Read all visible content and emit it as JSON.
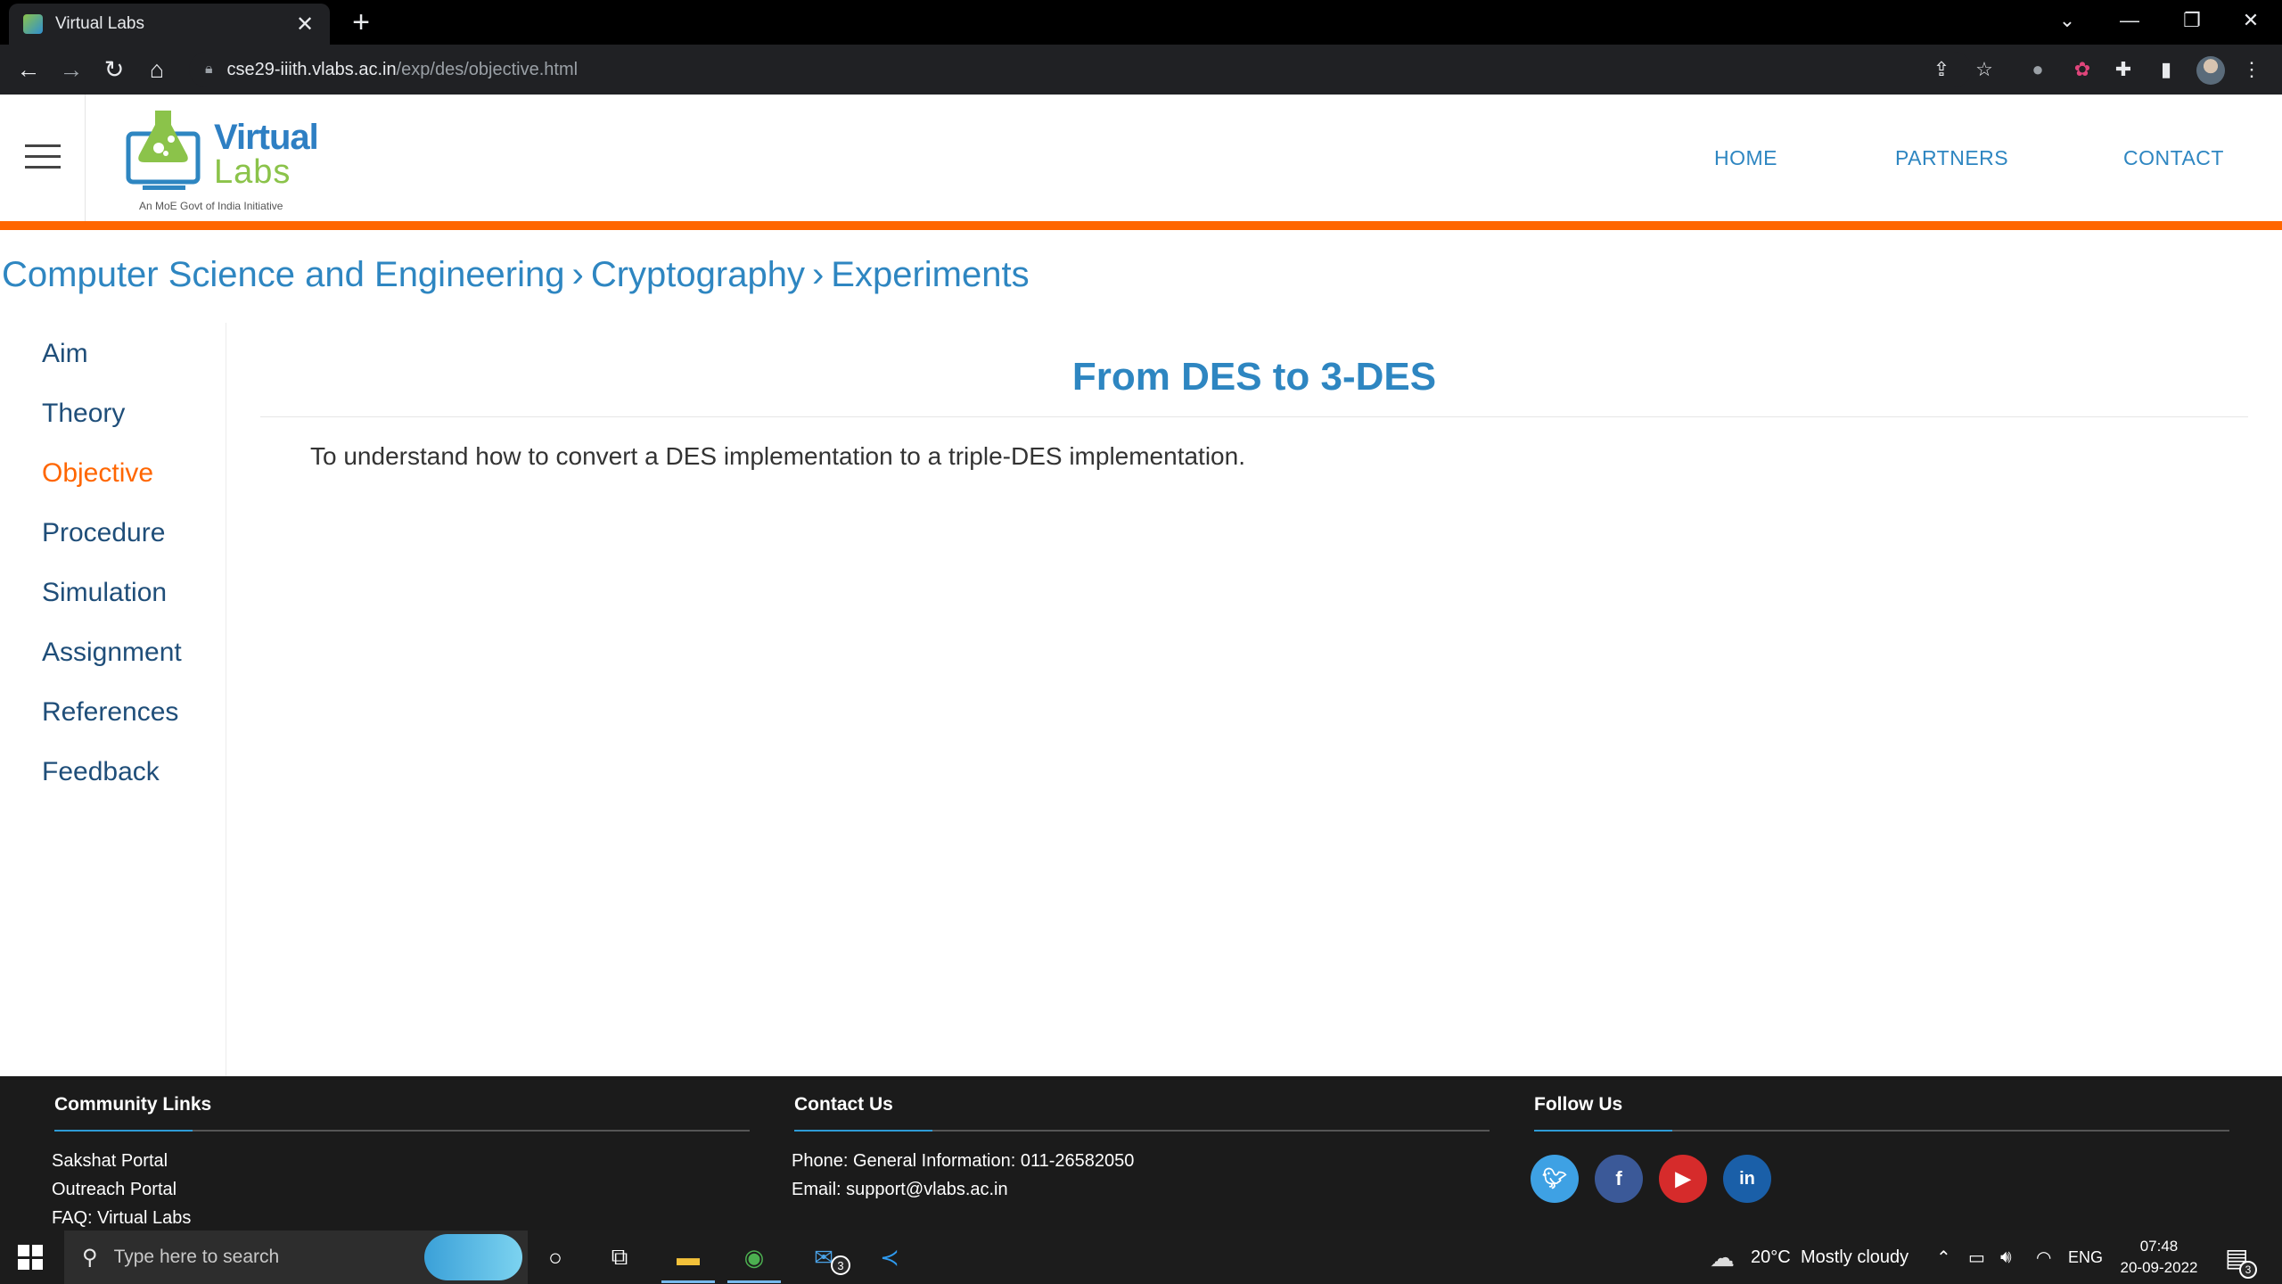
{
  "browser": {
    "tab_title": "Virtual Labs",
    "tab_close": "✕",
    "new_tab": "+",
    "url_host": "cse29-iiith.vlabs.ac.in",
    "url_path": "/exp/des/objective.html"
  },
  "site": {
    "logo_line1": "Virtual",
    "logo_line2": "Labs",
    "logo_tagline": "An MoE Govt of India Initiative",
    "nav": [
      "HOME",
      "PARTNERS",
      "CONTACT"
    ],
    "accent_color": "#ff6600",
    "link_color": "#2e86c1"
  },
  "breadcrumb": [
    "Computer Science and Engineering",
    "Cryptography",
    "Experiments"
  ],
  "sidebar": {
    "items": [
      "Aim",
      "Theory",
      "Objective",
      "Procedure",
      "Simulation",
      "Assignment",
      "References",
      "Feedback"
    ],
    "active": "Objective"
  },
  "main": {
    "title": "From DES to 3-DES",
    "objective": "To understand how to convert a DES implementation to a triple-DES implementation."
  },
  "footer": {
    "community_heading": "Community Links",
    "community_links": [
      "Sakshat Portal",
      "Outreach Portal",
      "FAQ: Virtual Labs"
    ],
    "contact_heading": "Contact Us",
    "phone": "Phone: General Information: 011-26582050",
    "email": "Email: support@vlabs.ac.in",
    "follow_heading": "Follow Us",
    "social": [
      "twitter-icon",
      "facebook-icon",
      "youtube-icon",
      "linkedin-icon"
    ]
  },
  "taskbar": {
    "search_placeholder": "Type here to search",
    "weather_temp": "20°C",
    "weather_desc": "Mostly cloudy",
    "language": "ENG",
    "time": "07:48",
    "date": "20-09-2022",
    "mail_badge": "3",
    "notification_badge": "3"
  }
}
